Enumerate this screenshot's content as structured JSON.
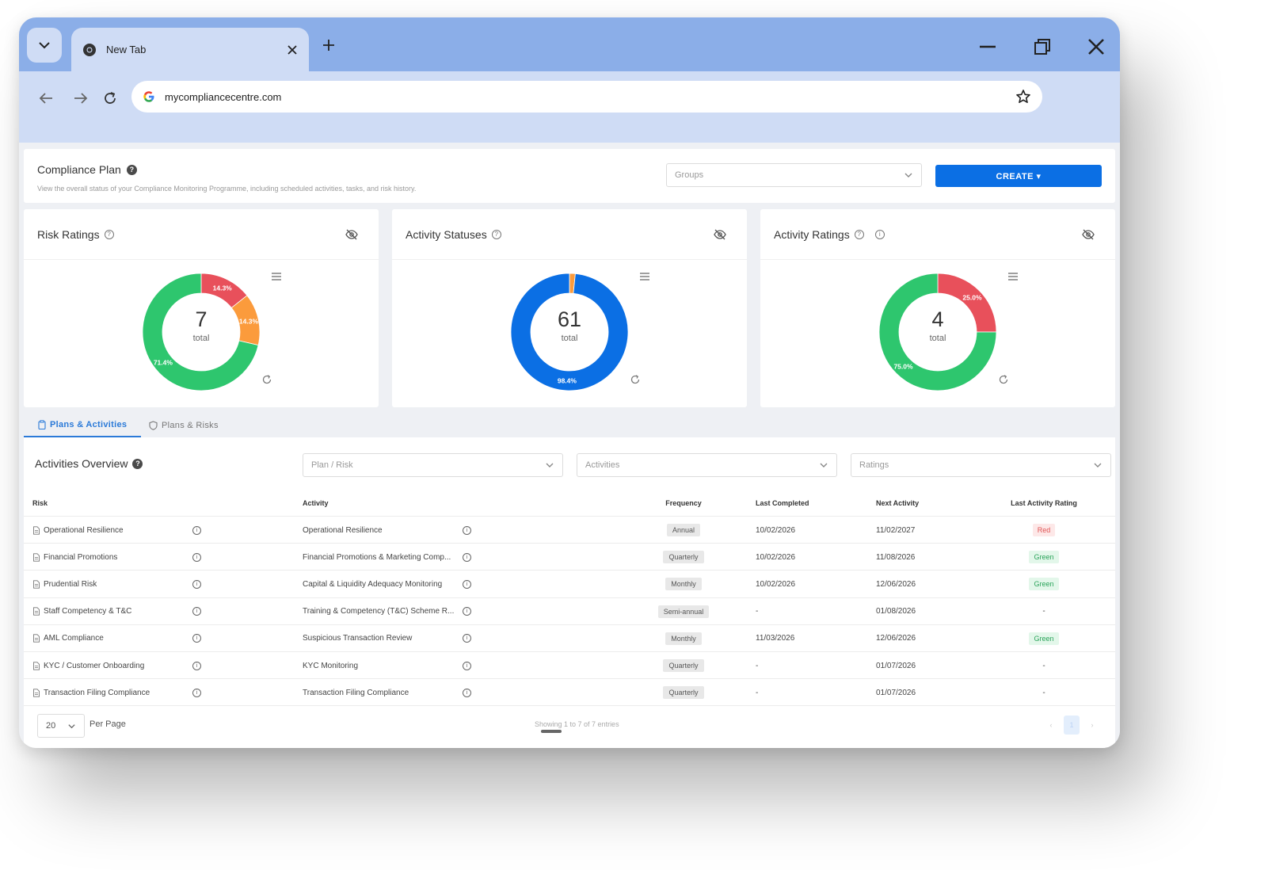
{
  "browser": {
    "tab_title": "New Tab",
    "url": "mycompliancecentre.com"
  },
  "header": {
    "title": "Compliance Plan",
    "subtitle": "View the overall status of your Compliance Monitoring Programme, including scheduled activities, tasks, and risk history.",
    "groups_placeholder": "Groups",
    "create_label": "CREATE ▾"
  },
  "cards": [
    {
      "title": "Risk Ratings",
      "total": "7",
      "total_label": "total",
      "chart_data": {
        "type": "pie",
        "title": "Risk Ratings",
        "slices": [
          {
            "label": "14.3%",
            "value": 14.3,
            "color": "#e8505b"
          },
          {
            "label": "14.3%",
            "value": 14.3,
            "color": "#fb9b3c"
          },
          {
            "label": "71.4%",
            "value": 71.4,
            "color": "#2ec66e"
          }
        ]
      }
    },
    {
      "title": "Activity Statuses",
      "total": "61",
      "total_label": "total",
      "chart_data": {
        "type": "pie",
        "title": "Activity Statuses",
        "slices": [
          {
            "label": "",
            "value": 1.6,
            "color": "#fb9b3c"
          },
          {
            "label": "98.4%",
            "value": 98.4,
            "color": "#0b6fe4"
          }
        ]
      }
    },
    {
      "title": "Activity Ratings",
      "total": "4",
      "total_label": "total",
      "chart_data": {
        "type": "pie",
        "title": "Activity Ratings",
        "slices": [
          {
            "label": "25.0%",
            "value": 25.0,
            "color": "#e8505b"
          },
          {
            "label": "75.0%",
            "value": 75.0,
            "color": "#2ec66e"
          }
        ]
      }
    }
  ],
  "tabs": {
    "plans_activities": "Plans & Activities",
    "plans_risks": "Plans & Risks"
  },
  "overview": {
    "title": "Activities Overview",
    "filter_plan": "Plan / Risk",
    "filter_activities": "Activities",
    "filter_ratings": "Ratings"
  },
  "table": {
    "headers": {
      "risk": "Risk",
      "activity": "Activity",
      "frequency": "Frequency",
      "last_completed": "Last Completed",
      "next_activity": "Next Activity",
      "last_rating": "Last Activity Rating"
    },
    "rows": [
      {
        "risk": "Operational Resilience",
        "activity": "Operational Resilience",
        "frequency": "Annual",
        "last_completed": "10/02/2026",
        "next_activity": "11/02/2027",
        "rating": "Red"
      },
      {
        "risk": "Financial Promotions",
        "activity": "Financial Promotions & Marketing Comp...",
        "frequency": "Quarterly",
        "last_completed": "10/02/2026",
        "next_activity": "11/08/2026",
        "rating": "Green"
      },
      {
        "risk": "Prudential Risk",
        "activity": "Capital & Liquidity Adequacy Monitoring",
        "frequency": "Monthly",
        "last_completed": "10/02/2026",
        "next_activity": "12/06/2026",
        "rating": "Green"
      },
      {
        "risk": "Staff Competency & T&C",
        "activity": "Training & Competency (T&C) Scheme R...",
        "frequency": "Semi-annual",
        "last_completed": "-",
        "next_activity": "01/08/2026",
        "rating": "-"
      },
      {
        "risk": "AML Compliance",
        "activity": "Suspicious Transaction Review",
        "frequency": "Monthly",
        "last_completed": "11/03/2026",
        "next_activity": "12/06/2026",
        "rating": "Green"
      },
      {
        "risk": "KYC / Customer Onboarding",
        "activity": "KYC Monitoring",
        "frequency": "Quarterly",
        "last_completed": "-",
        "next_activity": "01/07/2026",
        "rating": "-"
      },
      {
        "risk": "Transaction Filing Compliance",
        "activity": "Transaction Filing Compliance",
        "frequency": "Quarterly",
        "last_completed": "-",
        "next_activity": "01/07/2026",
        "rating": "-"
      }
    ]
  },
  "footer": {
    "per_page_value": "20",
    "per_page_label": "Per Page",
    "showing": "Showing 1 to 7 of 7 entries",
    "prev": "‹",
    "page": "1",
    "next": "›"
  },
  "colors": {
    "accent": "#0b6fe4",
    "red_badge_bg": "#fde8e8",
    "red_badge_fg": "#e05555",
    "green_badge_bg": "#e3f7ea",
    "green_badge_fg": "#2ba35a"
  }
}
